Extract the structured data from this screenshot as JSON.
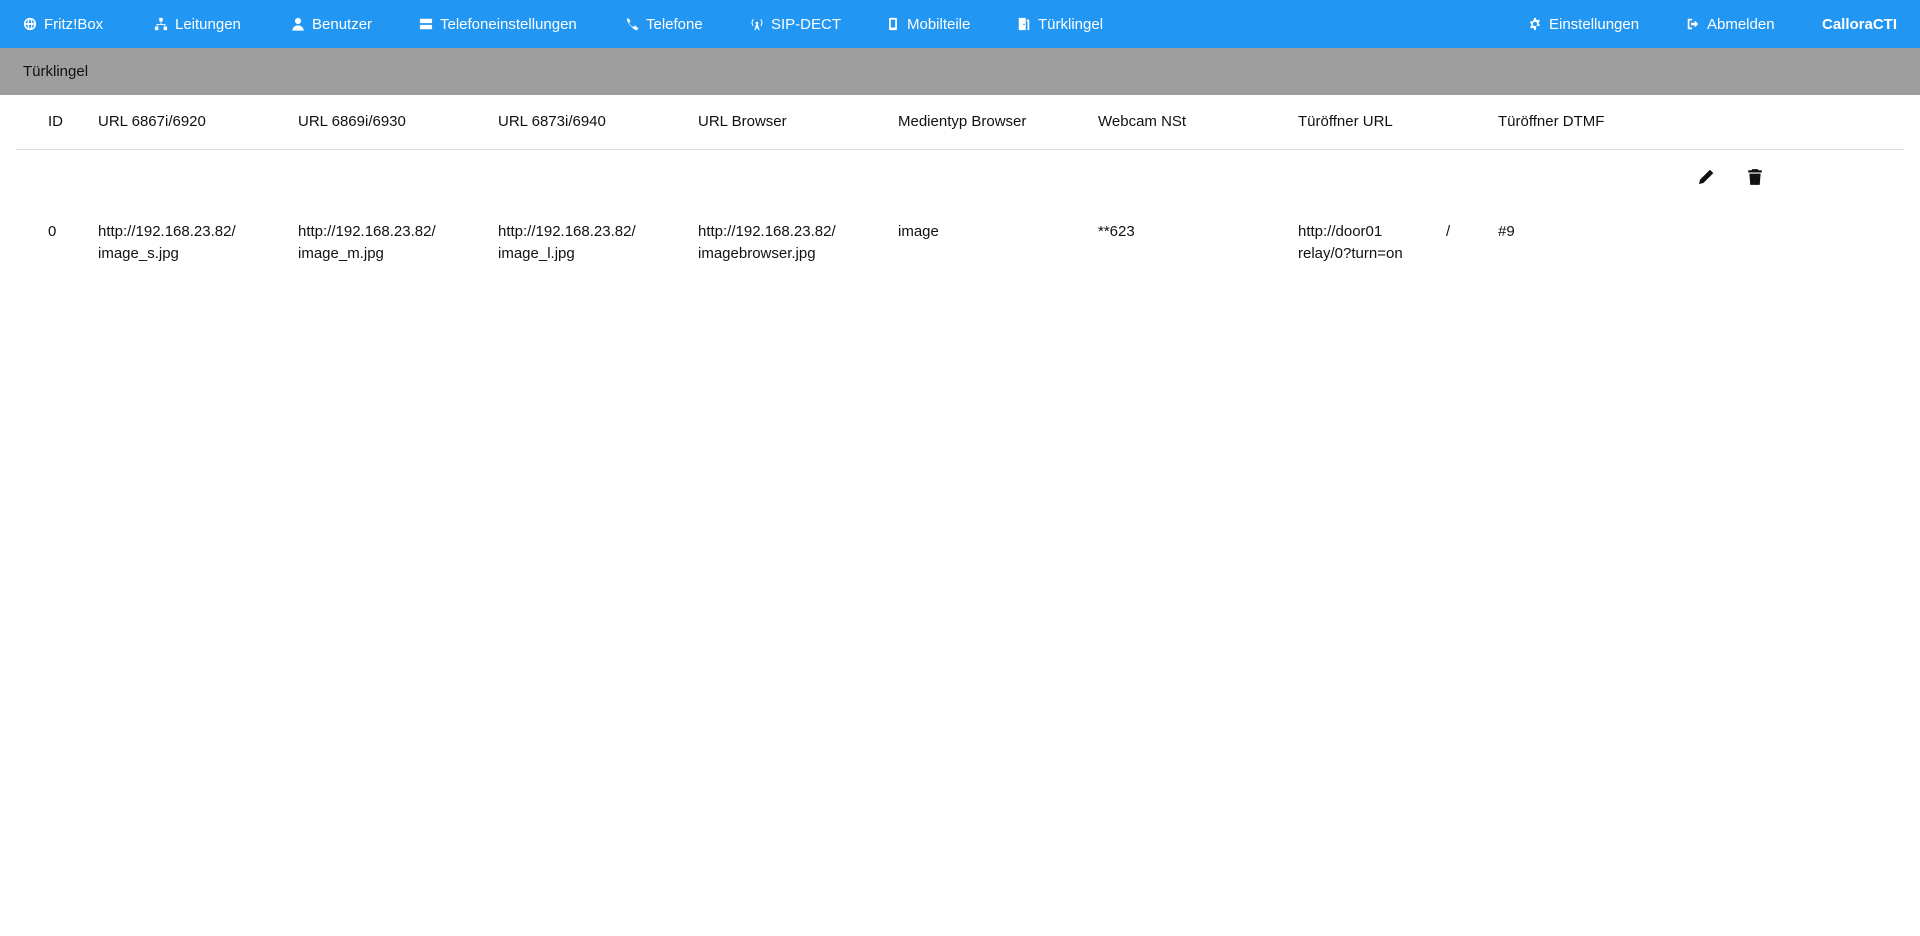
{
  "nav": {
    "items": [
      {
        "label": "Fritz!Box",
        "icon": "globe-icon"
      },
      {
        "label": "Leitungen",
        "icon": "network-icon"
      },
      {
        "label": "Benutzer",
        "icon": "user-icon"
      },
      {
        "label": "Telefoneinstellungen",
        "icon": "server-icon"
      },
      {
        "label": "Telefone",
        "icon": "phone-icon"
      },
      {
        "label": "SIP-DECT",
        "icon": "antenna-icon"
      },
      {
        "label": "Mobilteile",
        "icon": "mobile-icon"
      },
      {
        "label": "Türklingel",
        "icon": "door-icon"
      }
    ],
    "settings": {
      "label": "Einstellungen",
      "icon": "gear-icon"
    },
    "logout": {
      "label": "Abmelden",
      "icon": "sign-out-icon"
    },
    "brand": "CalloraCTI",
    "bg_color": "#2196f3"
  },
  "page": {
    "title": "Türklingel"
  },
  "table": {
    "headers": [
      "ID",
      "URL 6867i/6920",
      "URL 6869i/6930",
      "URL 6873i/6940",
      "URL Browser",
      "Medientyp Browser",
      "Webcam NSt",
      "Türöffner URL",
      "Türöffner DTMF"
    ],
    "rows": [
      {
        "id": "0",
        "url_6867": [
          "http://192.168.23.82/",
          "image_s.jpg"
        ],
        "url_6869": [
          "http://192.168.23.82/",
          "image_m.jpg"
        ],
        "url_6873": [
          "http://192.168.23.82/",
          "image_l.jpg"
        ],
        "url_browser": [
          "http://192.168.23.82/",
          "imagebrowser.jpg"
        ],
        "media_type": "image",
        "webcam_nst": "**623",
        "door_url": [
          "http://door01",
          "relay/0?turn=on"
        ],
        "door_url_sep": "/",
        "door_dtmf": "#9",
        "edit_icon": "pencil-icon",
        "delete_icon": "trash-icon"
      }
    ]
  }
}
